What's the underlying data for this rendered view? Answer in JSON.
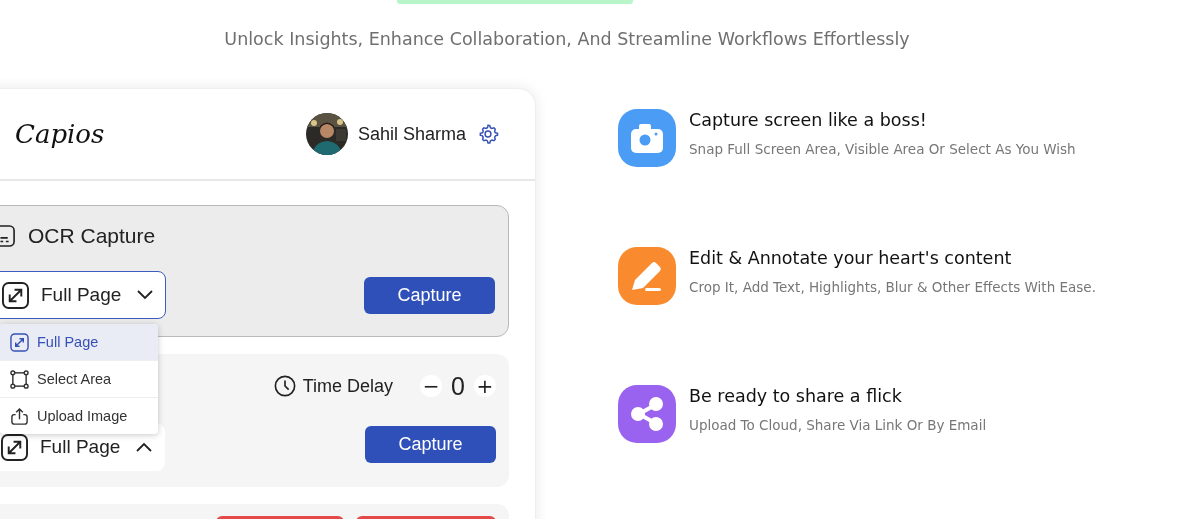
{
  "hero": {
    "subtitle": "Unlock Insights, Enhance Collaboration, And Streamline Workflows Effortlessly"
  },
  "app": {
    "logo": "Capios",
    "user": {
      "name": "Sahil Sharma"
    },
    "panels": [
      {
        "kind": "ocr",
        "title": "OCR Capture",
        "mode": {
          "label": "Full Page",
          "expanded": false,
          "focused": true
        },
        "button": "Capture"
      },
      {
        "kind": "delay",
        "delay_label": "Time Delay",
        "minus": "−",
        "delay_value": "0",
        "plus": "+",
        "mode": {
          "label": "Full Page",
          "expanded": true,
          "focused": false,
          "options": [
            {
              "label": "Full Page",
              "kind": "expand",
              "selected": true
            },
            {
              "label": "Select Area",
              "kind": "area",
              "selected": false
            },
            {
              "label": "Upload Image",
              "kind": "upload",
              "selected": false
            }
          ]
        },
        "button": "Capture"
      },
      {
        "kind": "cut"
      }
    ]
  },
  "features": [
    {
      "kind": "camera",
      "color": "#4a9cf5",
      "title": "Capture screen like a boss!",
      "text": "Snap Full Screen Area, Visible Area Or Select As You Wish"
    },
    {
      "kind": "pencil",
      "color": "#f98a2e",
      "title": "Edit & Annotate your heart's content",
      "text": "Crop It, Add Text, Highlights, Blur & Other Effects With Ease."
    },
    {
      "kind": "share",
      "color": "#9a63ef",
      "title": "Be ready to share a flick",
      "text": "Upload To Cloud, Share Via Link Or By Email"
    }
  ]
}
